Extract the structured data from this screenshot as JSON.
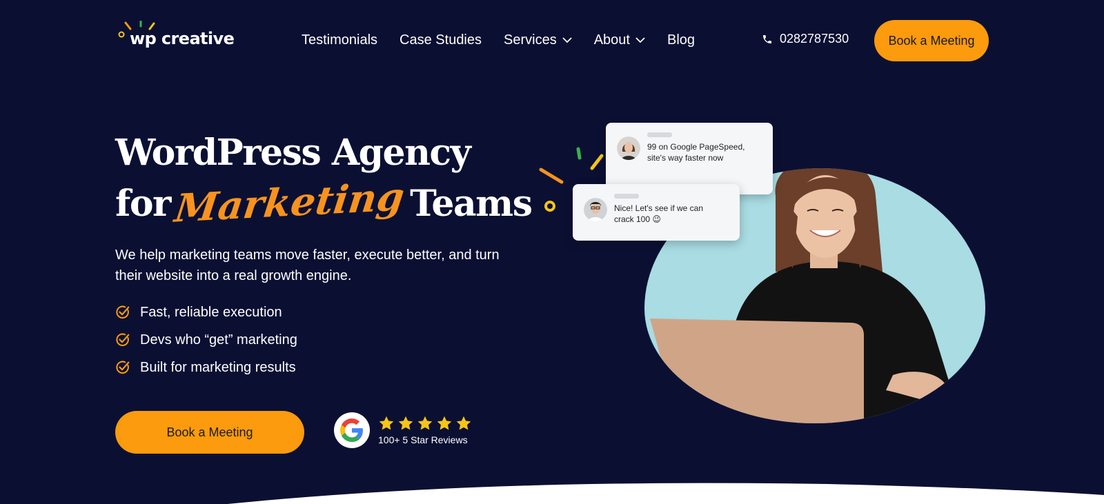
{
  "logo": {
    "text": "wp creative"
  },
  "nav": {
    "items": [
      {
        "label": "Testimonials",
        "dropdown": false
      },
      {
        "label": "Case Studies",
        "dropdown": false
      },
      {
        "label": "Services",
        "dropdown": true
      },
      {
        "label": "About",
        "dropdown": true
      },
      {
        "label": "Blog",
        "dropdown": false
      }
    ]
  },
  "header": {
    "phone": "0282787530",
    "cta_label": "Book a Meeting"
  },
  "hero": {
    "title_line1": "WordPress Agency",
    "title_for": "for",
    "title_script": "Marketing",
    "title_end": "Teams",
    "subtitle": "We help marketing teams move faster, execute better, and turn their website into a real growth engine.",
    "checks": [
      "Fast, reliable execution",
      "Devs who “get” marketing",
      "Built for marketing results"
    ],
    "cta_label": "Book a Meeting",
    "reviews_text": "100+ 5 Star Reviews",
    "stars": 5
  },
  "chat": {
    "card1_text": "99 on Google PageSpeed, site's way faster now",
    "card2_text": "Nice! Let's see if we can crack 100 😉"
  },
  "colors": {
    "background": "#0b1033",
    "accent": "#fb9b0d",
    "blob": "#a9dce3",
    "star": "#f5c518"
  }
}
